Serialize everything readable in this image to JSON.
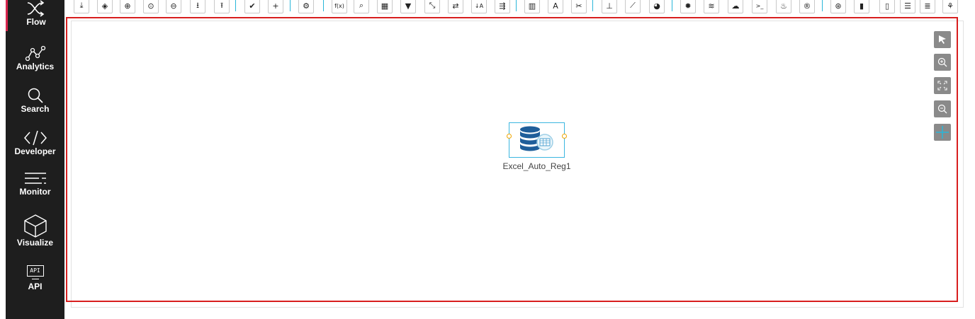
{
  "sidebar": {
    "items": [
      {
        "label": "Flow",
        "icon": "flow-icon"
      },
      {
        "label": "Analytics",
        "icon": "analytics-icon"
      },
      {
        "label": "Search",
        "icon": "search-icon"
      },
      {
        "label": "Developer",
        "icon": "code-icon"
      },
      {
        "label": "Monitor",
        "icon": "monitor-icon"
      },
      {
        "label": "Visualize",
        "icon": "cube-icon"
      },
      {
        "label": "API",
        "icon": "api-icon",
        "icon_text": "API"
      }
    ],
    "active": "Flow",
    "accent_color": "#d6244d",
    "background": "#1e1e1e"
  },
  "toolbar": {
    "buttons": [
      {
        "name": "download-check",
        "glyph": "⤓"
      },
      {
        "name": "eye-off",
        "glyph": "◈"
      },
      {
        "name": "add-circle",
        "glyph": "⊕"
      },
      {
        "name": "target",
        "glyph": "⊙"
      },
      {
        "name": "remove-circle",
        "glyph": "⊖"
      },
      {
        "name": "download",
        "glyph": "⭳"
      },
      {
        "name": "upload",
        "glyph": "⭱"
      },
      {
        "name": "check",
        "glyph": "✔"
      },
      {
        "name": "plus",
        "glyph": "+"
      },
      {
        "name": "settings-group",
        "glyph": "⚙"
      },
      {
        "name": "function",
        "glyph": "f(x)"
      },
      {
        "name": "search",
        "glyph": "⌕"
      },
      {
        "name": "excel",
        "glyph": "▦"
      },
      {
        "name": "filter",
        "glyph": "▼"
      },
      {
        "name": "collapse",
        "glyph": "⤡"
      },
      {
        "name": "swap",
        "glyph": "⇄"
      },
      {
        "name": "sort-az",
        "glyph": "↓A"
      },
      {
        "name": "route",
        "glyph": "⇶"
      },
      {
        "name": "bar-chart",
        "glyph": "▥"
      },
      {
        "name": "text",
        "glyph": "A"
      },
      {
        "name": "cut",
        "glyph": "✂"
      },
      {
        "name": "hierarchy",
        "glyph": "⊥"
      },
      {
        "name": "line-chart",
        "glyph": "⟋"
      },
      {
        "name": "pie-chart",
        "glyph": "◕"
      },
      {
        "name": "gear",
        "glyph": "✹"
      },
      {
        "name": "database",
        "glyph": "≋"
      },
      {
        "name": "brain",
        "glyph": "☁"
      },
      {
        "name": "terminal",
        "glyph": ">_"
      },
      {
        "name": "java",
        "glyph": "♨"
      },
      {
        "name": "r-lang",
        "glyph": "®"
      },
      {
        "name": "globe",
        "glyph": "⊛"
      },
      {
        "name": "file",
        "glyph": "▮"
      },
      {
        "name": "cylinder",
        "glyph": "▯"
      },
      {
        "name": "indent",
        "glyph": "☰"
      },
      {
        "name": "db-stack",
        "glyph": "≣"
      },
      {
        "name": "hive",
        "glyph": "⚘"
      }
    ],
    "separator_color": "#29b6d9"
  },
  "canvas": {
    "selection_color": "#d81e1e",
    "tools": [
      {
        "name": "pointer-icon",
        "glyph": "➤"
      },
      {
        "name": "zoom-in-icon",
        "glyph": "⊕"
      },
      {
        "name": "fit-screen-icon",
        "glyph": "⤢"
      },
      {
        "name": "zoom-out-icon",
        "glyph": "⊖"
      },
      {
        "name": "pan-icon",
        "glyph": "✥"
      }
    ],
    "node": {
      "label": "Excel_Auto_Reg1",
      "icon": "database-excel-icon",
      "border_color": "#3bb6e0",
      "port_color": "#f0a500"
    }
  }
}
